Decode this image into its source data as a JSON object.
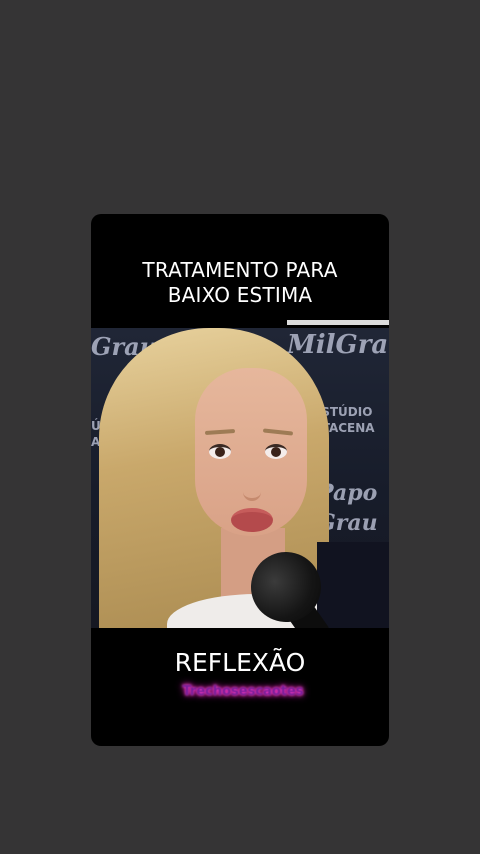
{
  "video": {
    "title": "TRATAMENTO PARA\nBAIXO ESTIMA",
    "caption": "REFLEXÃO",
    "handle": "Trechosescaotes",
    "backdrop": {
      "logo_left": "Grau",
      "logo_right": "MilGrau",
      "studio_right": "ESTÚDIO\nRTACENA",
      "studio_left": "ÚDIO\nAC",
      "podcast_right": "Papo\nGrau"
    },
    "progress": 0.66
  }
}
